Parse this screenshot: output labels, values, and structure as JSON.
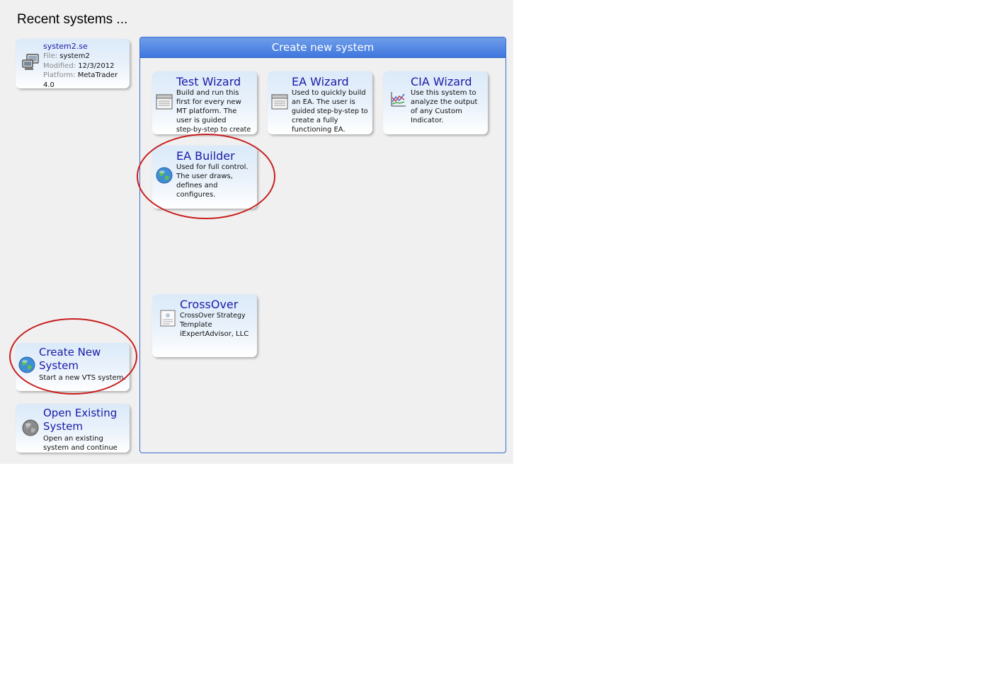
{
  "recent": {
    "heading": "Recent systems ...",
    "item": {
      "name": "system2.se",
      "file_label": "File:",
      "file": "system2",
      "modified_label": "Modified:",
      "modified": "12/3/2012",
      "platform_label": "Platform:",
      "platform": "MetaTrader",
      "platform_version": "4.0"
    }
  },
  "actions": {
    "create_new": {
      "title_line1": "Create New",
      "title_line2": "System",
      "desc": "Start a new VTS system."
    },
    "open_existing": {
      "title_line1": "Open Existing",
      "title_line2": "System",
      "desc_line1": "Open an existing",
      "desc_line2": "system and continue"
    }
  },
  "panel": {
    "title": "Create new system",
    "cards": {
      "test_wizard": {
        "title": "Test Wizard",
        "desc": [
          "Build and run this",
          "first for every new",
          "MT platform. The",
          "user is guided",
          "step-by-step to create"
        ]
      },
      "ea_wizard": {
        "title": "EA Wizard",
        "desc": [
          "Used to quickly build",
          "an EA. The user is",
          "guided step-by-step to",
          "create a fully",
          "functioning EA."
        ]
      },
      "cia_wizard": {
        "title": "CIA Wizard",
        "desc": [
          "Use this system to",
          "analyze the output",
          "of any Custom",
          "Indicator."
        ]
      },
      "ea_builder": {
        "title": "EA Builder",
        "desc": [
          "Used for full control.",
          "The user draws,",
          "defines and",
          "configures."
        ]
      },
      "crossover": {
        "title": "CrossOver",
        "desc": [
          "CrossOver Strategy",
          "Template",
          "iExpertAdvisor, LLC"
        ]
      }
    }
  },
  "annotation_color": "#c81e1e",
  "icons": [
    "computer-icon",
    "window-icon",
    "chart-icon",
    "globe-icon",
    "template-icon"
  ]
}
